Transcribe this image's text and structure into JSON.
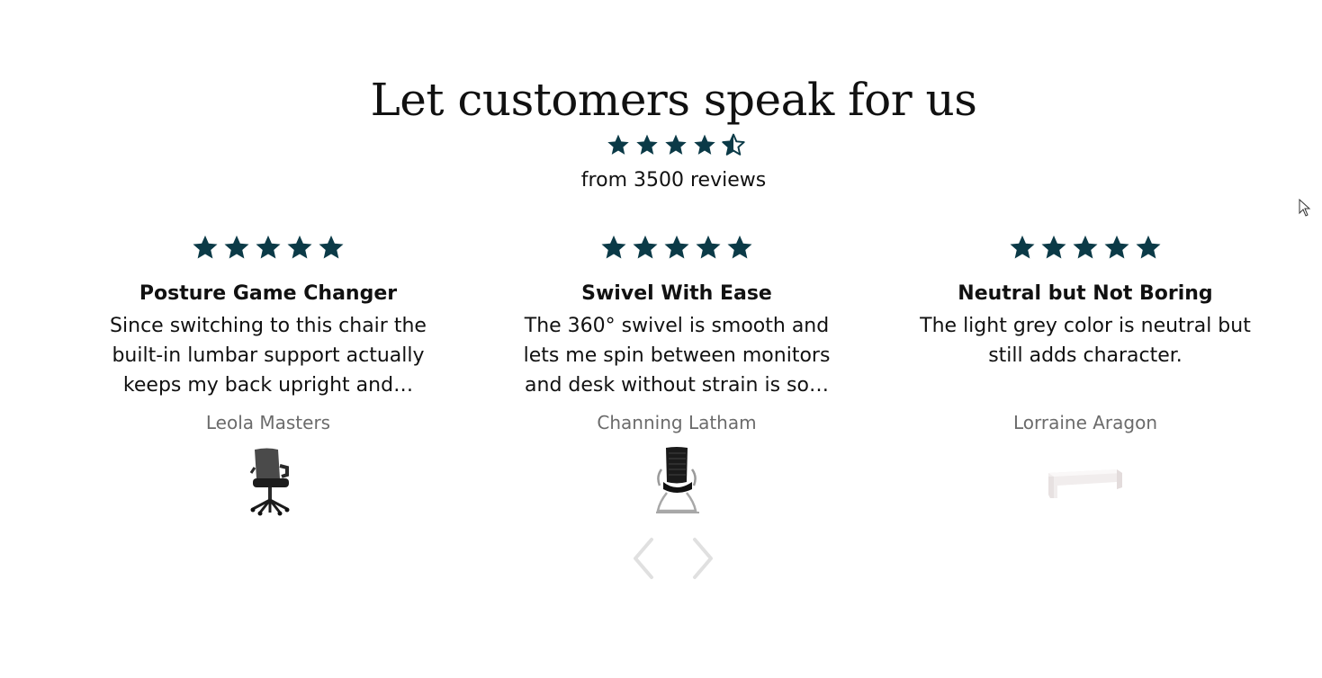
{
  "section": {
    "title": "Let customers speak for us",
    "overall_rating": 4.5,
    "review_count_text": "from 3500 reviews",
    "star_icon": "star-icon",
    "star_color": "#0b3a47"
  },
  "reviews": [
    {
      "rating": 5,
      "title": "Posture Game Changer",
      "body": "Since switching to this chair the built-in lumbar support actually keeps my back upright and…",
      "author": "Leola Masters",
      "product_image": "office-chair-mesh-image"
    },
    {
      "rating": 5,
      "title": "Swivel With Ease",
      "body": "The 360° swivel is smooth and lets me spin between monitors and desk without strain is so…",
      "author": "Channing Latham",
      "product_image": "office-chair-sled-base-image"
    },
    {
      "rating": 5,
      "title": "Neutral but Not Boring",
      "body": "The light grey color is neutral but still adds character.",
      "author": "Lorraine Aragon",
      "product_image": "white-bench-image"
    }
  ],
  "navigation": {
    "prev_icon": "chevron-left-icon",
    "next_icon": "chevron-right-icon",
    "color": "#e0e0e0"
  }
}
